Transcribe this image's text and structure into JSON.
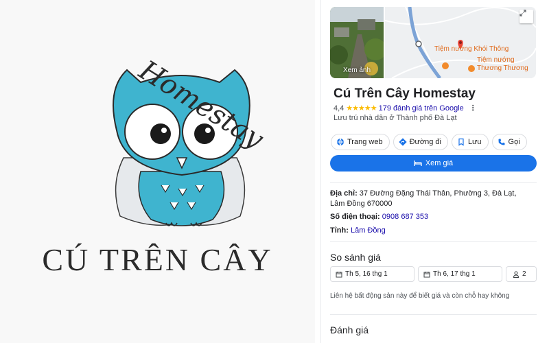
{
  "logo": {
    "script_text": "Homestay",
    "name": "CÚ TRÊN CÂY"
  },
  "panel": {
    "photo_label": "Xem ảnh",
    "map_labels": {
      "restaurant_1": "Tiệm nướng Khói Thông",
      "restaurant_2_line1": "Tiệm nướng",
      "restaurant_2_line2": "Thương Thương"
    },
    "title": "Cú Trên Cây Homestay",
    "rating": "4,4",
    "stars": "★★★★★",
    "reviews": "179 đánh giá trên Google",
    "category": "Lưu trú nhà dân ở Thành phố Đà Lạt",
    "actions": [
      {
        "label": "Trang web",
        "icon": "globe-icon"
      },
      {
        "label": "Đường đi",
        "icon": "directions-icon"
      },
      {
        "label": "Lưu",
        "icon": "bookmark-icon"
      },
      {
        "label": "Gọi",
        "icon": "phone-icon"
      }
    ],
    "cta_label": "Xem giá",
    "address_label": "Địa chỉ:",
    "address_value": "37 Đường Đặng Thái Thân, Phường 3, Đà Lạt, Lâm Đồng 670000",
    "phone_label": "Số điện thoại:",
    "phone_value": "0908 687 353",
    "province_label": "Tỉnh:",
    "province_value": "Lâm Đồng",
    "compare_title": "So sánh giá",
    "checkin": "Th 5, 16 thg 1",
    "checkout": "Th 6, 17 thg 1",
    "guests": "2",
    "note": "Liên hệ bất động sản này để biết giá và còn chỗ hay không",
    "reviews_title": "Đánh giá"
  },
  "colors": {
    "accent": "#1a73e8",
    "link": "#1a0dab",
    "star": "#fbbc04",
    "owl": "#3fb4cf",
    "map_pin": "#ea4335",
    "map_poi": "#f28b2c"
  }
}
